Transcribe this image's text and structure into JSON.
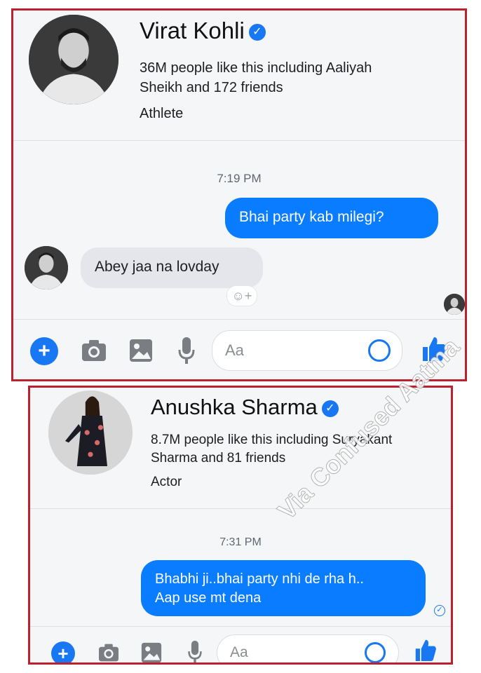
{
  "panel1": {
    "name": "Virat Kohli",
    "likes_line1": "36M people like this including Aaliyah",
    "likes_line2": "Sheikh and 172 friends",
    "category": "Athlete",
    "time": "7:19 PM",
    "outgoing": "Bhai party kab milegi?",
    "incoming": "Abey jaa na lovday",
    "reaction_icon": "add-reaction-icon",
    "input_placeholder": "Aa"
  },
  "panel2": {
    "name": "Anushka Sharma",
    "likes_line1": "8.7M people like this including Suryakant",
    "likes_line2": "Sharma and 81 friends",
    "category": "Actor",
    "time": "7:31 PM",
    "outgoing_line1": "Bhabhi ji..bhai party nhi de rha h..",
    "outgoing_line2": "Aap use mt dena",
    "input_placeholder": "Aa"
  },
  "watermark": "Via Confused Aatma",
  "colors": {
    "messenger_blue": "#0a7cff",
    "border_red": "#b8232f",
    "verified_blue": "#1877f2"
  }
}
